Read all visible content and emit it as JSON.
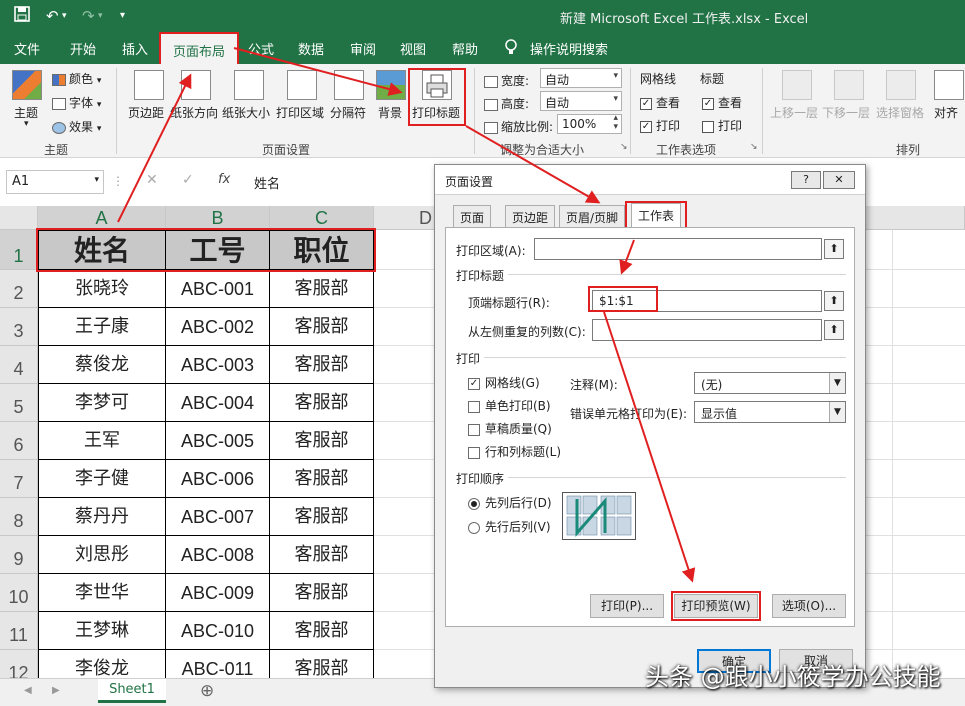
{
  "title": {
    "save_icon": "save-icon",
    "undo": "↶",
    "redo": "↷",
    "window_title": "新建 Microsoft Excel 工作表.xlsx  -  Excel"
  },
  "tabs": [
    "文件",
    "开始",
    "插入",
    "页面布局",
    "公式",
    "数据",
    "审阅",
    "视图",
    "帮助",
    "操作说明搜索"
  ],
  "ribbon": {
    "theme": {
      "main": "主题",
      "colors": "颜色",
      "fonts": "字体",
      "effects": "效果",
      "group": "主题"
    },
    "page_setup": {
      "margins": "页边距",
      "orientation": "纸张方向",
      "size": "纸张大小",
      "print_area": "打印区域",
      "breaks": "分隔符",
      "background": "背景",
      "print_titles": "打印标题",
      "group": "页面设置"
    },
    "scale": {
      "width_label": "宽度:",
      "width_value": "自动",
      "height_label": "高度:",
      "height_value": "自动",
      "scale_label": "缩放比例:",
      "scale_value": "100%",
      "group": "调整为合适大小"
    },
    "sheet_options": {
      "gridlines": "网格线",
      "headings": "标题",
      "view": "查看",
      "print": "打印",
      "group": "工作表选项"
    },
    "arrange": {
      "forward": "上移一层",
      "backward": "下移一层",
      "pane": "选择窗格",
      "align": "对齐",
      "group": "排列"
    }
  },
  "formula_bar": {
    "name_box": "A1",
    "fx": "fx",
    "content": "姓名"
  },
  "sheet": {
    "columns": [
      "A",
      "B",
      "C",
      "D"
    ],
    "header_row": [
      "姓名",
      "工号",
      "职位"
    ],
    "rows": [
      [
        "张晓玲",
        "ABC-001",
        "客服部"
      ],
      [
        "王子康",
        "ABC-002",
        "客服部"
      ],
      [
        "蔡俊龙",
        "ABC-003",
        "客服部"
      ],
      [
        "李梦可",
        "ABC-004",
        "客服部"
      ],
      [
        "王军",
        "ABC-005",
        "客服部"
      ],
      [
        "李子健",
        "ABC-006",
        "客服部"
      ],
      [
        "蔡丹丹",
        "ABC-007",
        "客服部"
      ],
      [
        "刘思彤",
        "ABC-008",
        "客服部"
      ],
      [
        "李世华",
        "ABC-009",
        "客服部"
      ],
      [
        "王梦琳",
        "ABC-010",
        "客服部"
      ],
      [
        "李俊龙",
        "ABC-011",
        "客服部"
      ]
    ],
    "row_numbers": [
      "1",
      "2",
      "3",
      "4",
      "5",
      "6",
      "7",
      "8",
      "9",
      "10",
      "11",
      "12"
    ],
    "tab_name": "Sheet1",
    "add_sheet": "⊕"
  },
  "dialog": {
    "title": "页面设置",
    "help": "?",
    "close": "✕",
    "tabs": [
      "页面",
      "页边距",
      "页眉/页脚",
      "工作表"
    ],
    "print_area_label": "打印区域(A):",
    "print_titles_section": "打印标题",
    "rows_repeat_label": "顶端标题行(R):",
    "rows_repeat_value": "$1:$1",
    "cols_repeat_label": "从左侧重复的列数(C):",
    "print_section": "打印",
    "gridlines": "网格线(G)",
    "bw": "单色打印(B)",
    "draft": "草稿质量(Q)",
    "rowcol_headings": "行和列标题(L)",
    "comments_label": "注释(M):",
    "comments_value": "(无)",
    "errors_label": "错误单元格打印为(E):",
    "errors_value": "显示值",
    "order_section": "打印顺序",
    "down_then_over": "先列后行(D)",
    "over_then_down": "先行后列(V)",
    "print_btn": "打印(P)...",
    "preview_btn": "打印预览(W)",
    "options_btn": "选项(O)...",
    "ok": "确定",
    "cancel": "取消"
  },
  "watermark": "头条 @跟小小筱学办公技能"
}
